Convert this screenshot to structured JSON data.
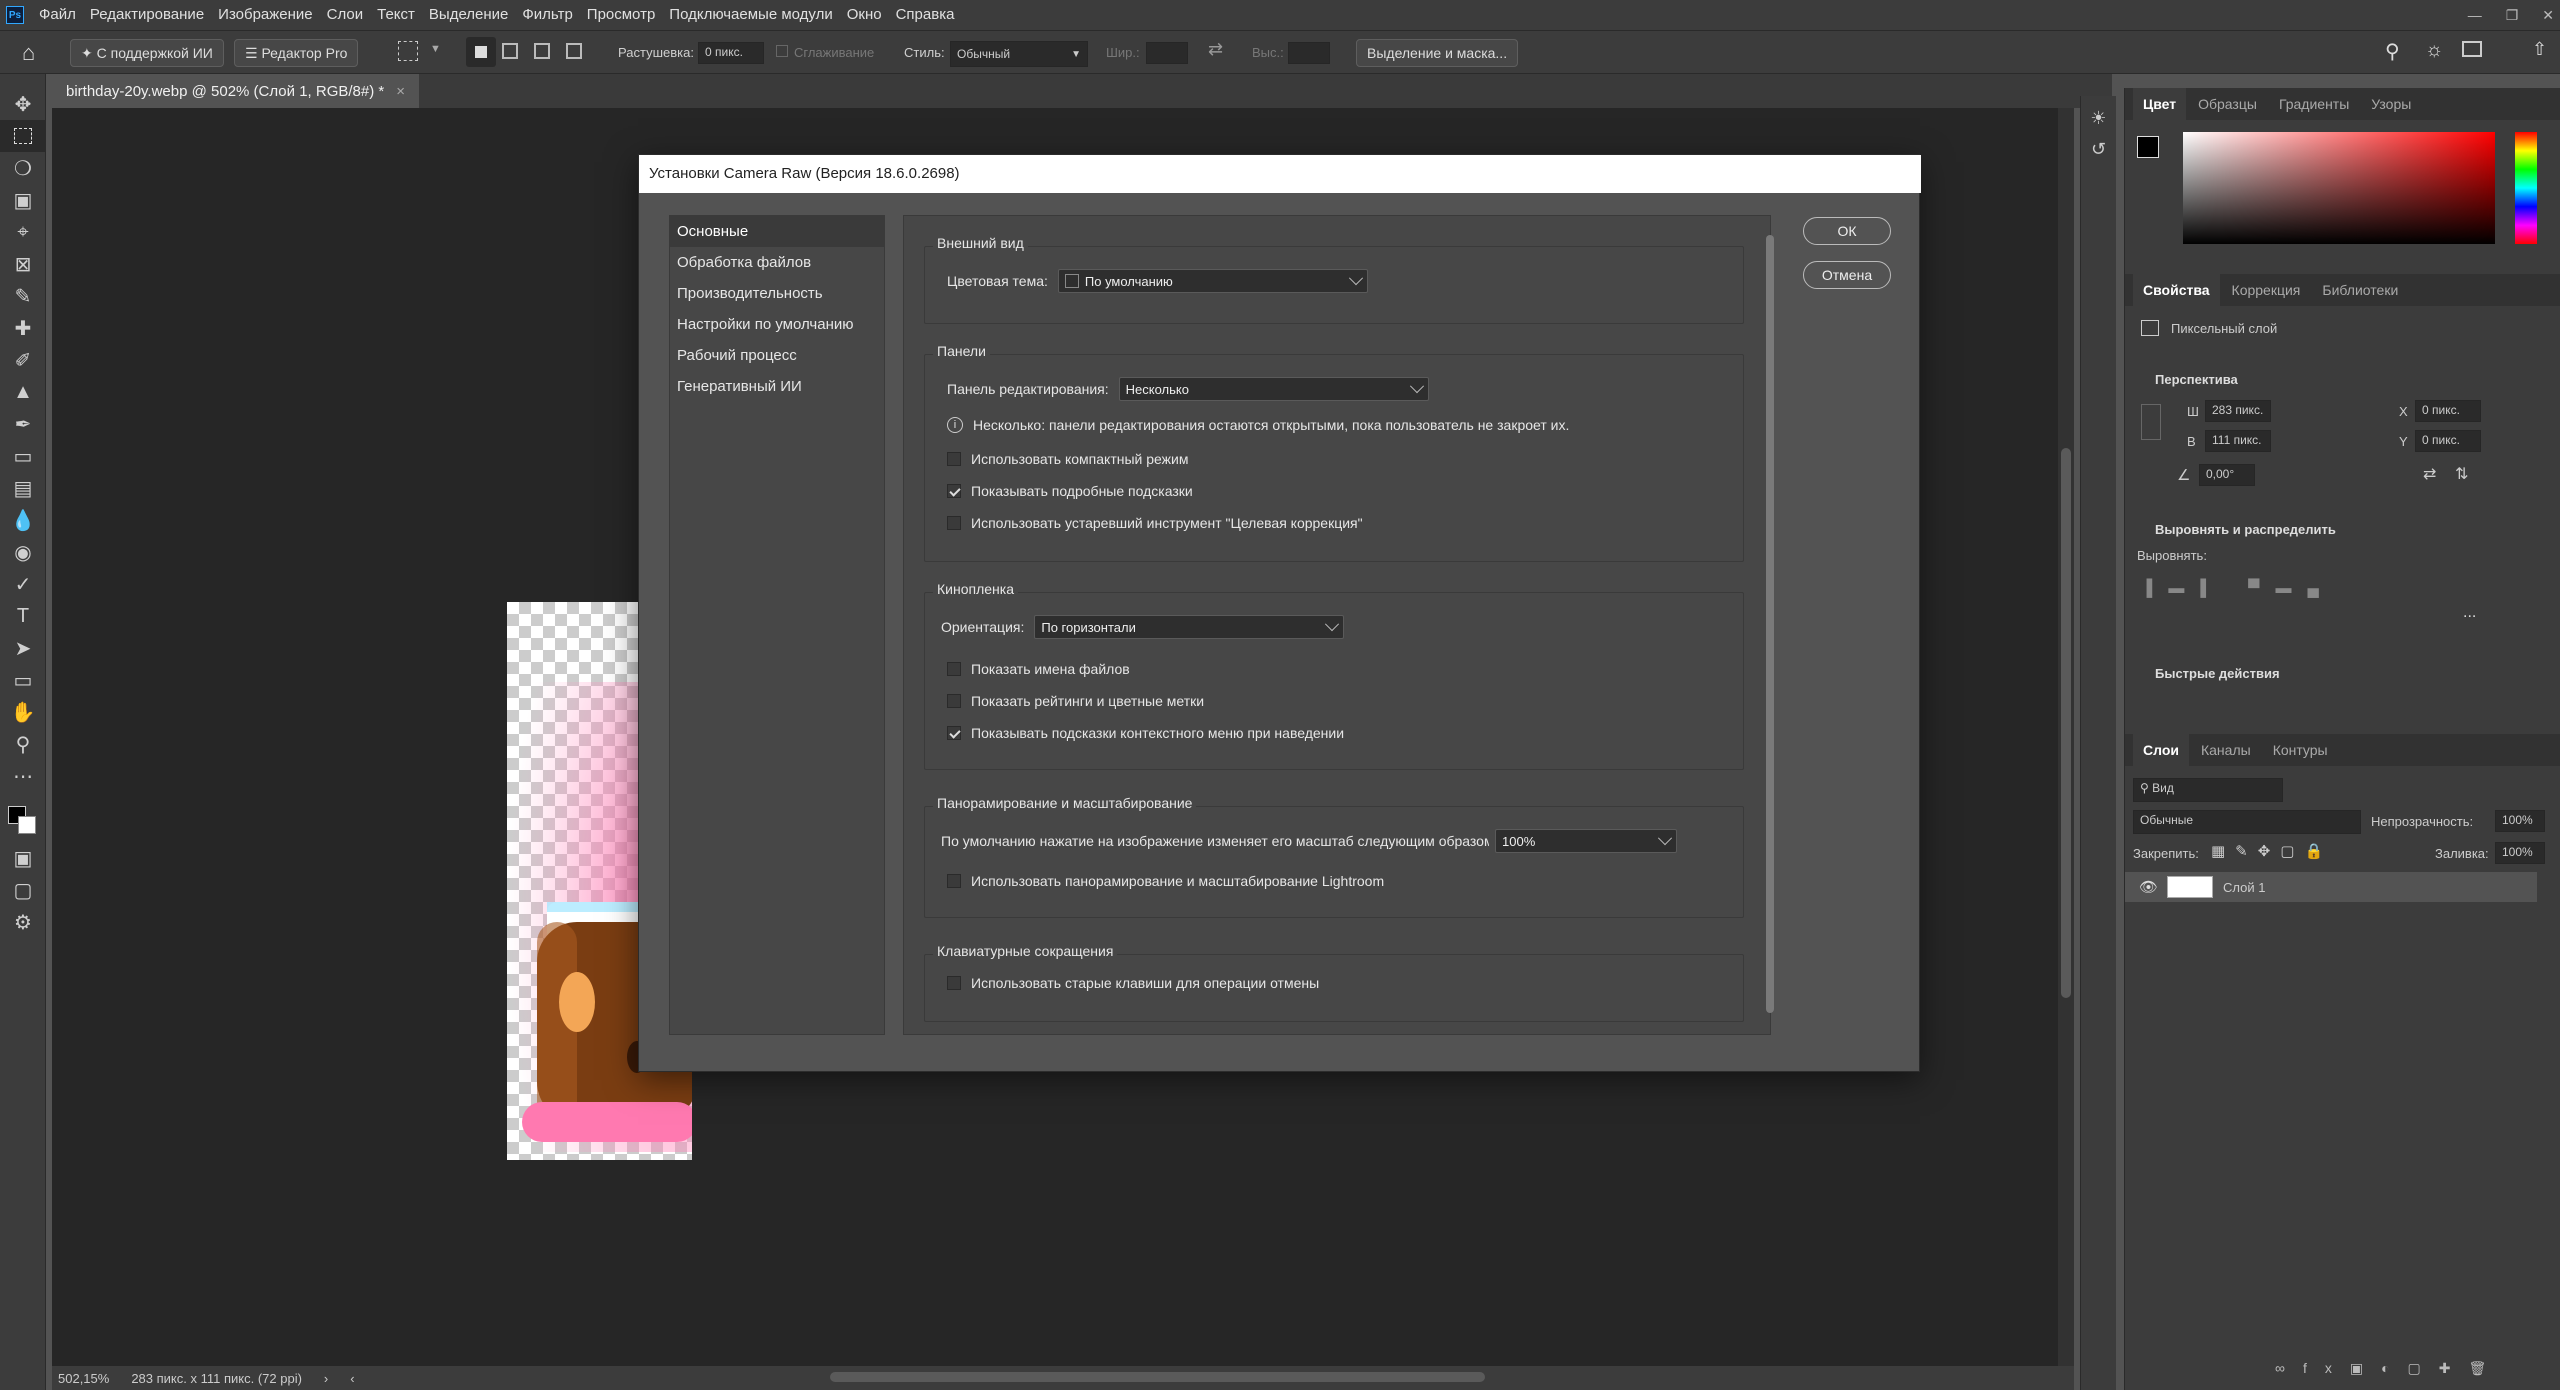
{
  "menubar": {
    "logo": "Ps",
    "items": [
      "Файл",
      "Редактирование",
      "Изображение",
      "Слои",
      "Текст",
      "Выделение",
      "Фильтр",
      "Просмотр",
      "Подключаемые модули",
      "Окно",
      "Справка"
    ]
  },
  "optionsbar": {
    "ai_button": "С поддержкой ИИ",
    "pro_editor": "Редактор Pro",
    "feather_label": "Растушевка:",
    "feather_value": "0 пикс.",
    "antialias_label": "Сглаживание",
    "style_label": "Стиль:",
    "style_value": "Обычный",
    "width_label": "Шир.:",
    "height_label": "Выс.:",
    "select_mask": "Выделение и маска..."
  },
  "document": {
    "tab_title": "birthday-20y.webp @ 502% (Слой 1, RGB/8#) *",
    "tab_close": "×"
  },
  "statusbar": {
    "zoom": "502,15%",
    "info": "283 пикс. x 111 пикс. (72 ppi)"
  },
  "color_panel": {
    "tabs": [
      "Цвет",
      "Образцы",
      "Градиенты",
      "Узоры"
    ]
  },
  "properties_panel": {
    "tabs": [
      "Свойства",
      "Коррекция",
      "Библиотеки"
    ],
    "layer_type": "Пиксельный слой",
    "perspective_title": "Перспектива",
    "w_label": "Ш",
    "w_value": "283 пикс.",
    "h_label": "В",
    "h_value": "111 пикс.",
    "x_label": "X",
    "x_value": "0 пикс.",
    "y_label": "Y",
    "y_value": "0 пикс.",
    "angle_value": "0,00°",
    "align_title": "Выровнять и распределить",
    "align_label": "Выровнять:",
    "more": "...",
    "quick_actions": "Быстрые действия"
  },
  "layers_panel": {
    "tabs": [
      "Слои",
      "Каналы",
      "Контуры"
    ],
    "search_value": "Вид",
    "blend_mode": "Обычные",
    "opacity_label": "Непрозрачность:",
    "opacity_value": "100%",
    "lock_label": "Закрепить:",
    "fill_label": "Заливка:",
    "fill_value": "100%",
    "layer_name": "Слой 1"
  },
  "dialog": {
    "title": "Установки Camera Raw  (Версия 18.6.0.2698)",
    "nav": [
      "Основные",
      "Обработка файлов",
      "Производительность",
      "Настройки по умолчанию",
      "Рабочий процесс",
      "Генеративный ИИ"
    ],
    "ok": "ОК",
    "cancel": "Отмена",
    "appearance": {
      "title": "Внешний вид",
      "theme_label": "Цветовая тема:",
      "theme_value": "По умолчанию"
    },
    "panels": {
      "title": "Панели",
      "edit_panel_label": "Панель редактирования:",
      "edit_panel_value": "Несколько",
      "info_text": "Несколько: панели редактирования остаются открытыми, пока пользователь не закроет их.",
      "compact": "Использовать компактный режим",
      "tooltips": "Показывать подробные подсказки",
      "legacy_tool": "Использовать устаревший инструмент \"Целевая коррекция\""
    },
    "filmstrip": {
      "title": "Кинопленка",
      "orientation_label": "Ориентация:",
      "orientation_value": "По горизонтали",
      "show_names": "Показать имена файлов",
      "show_ratings": "Показать рейтинги и цветные метки",
      "hover_hints": "Показывать подсказки контекстного меню при наведении"
    },
    "pan_zoom": {
      "title": "Панорамирование и масштабирование",
      "default_label": "По умолчанию нажатие на изображение изменяет его масштаб следующим образом",
      "default_value": "100%",
      "lightroom": "Использовать панорамирование и масштабирование Lightroom"
    },
    "shortcuts": {
      "title": "Клавиатурные сокращения",
      "legacy_undo": "Использовать старые клавиши для операции отмены"
    }
  }
}
